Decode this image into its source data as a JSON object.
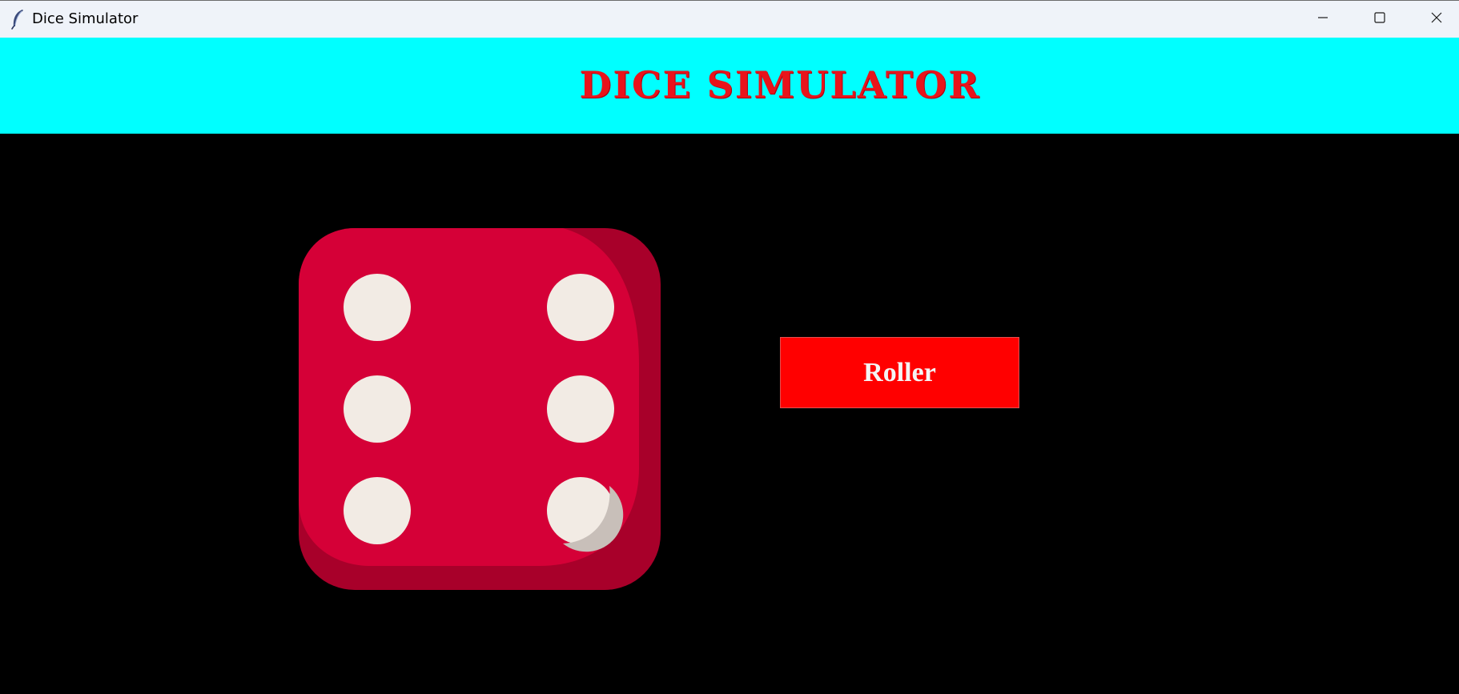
{
  "window": {
    "title": "Dice Simulator"
  },
  "header": {
    "title": "DICE SIMULATOR",
    "background": "#00ffff",
    "title_color": "#e8141b"
  },
  "dice": {
    "face_value": 6,
    "face_color": "#d50037",
    "shadow_color": "#a8002a",
    "pip_color": "#f2ebe4"
  },
  "roll_button": {
    "label": "Roller",
    "background": "#ff0000"
  },
  "icons": {
    "app": "feather-icon",
    "minimize": "minimize-icon",
    "maximize": "maximize-icon",
    "close": "close-icon"
  }
}
